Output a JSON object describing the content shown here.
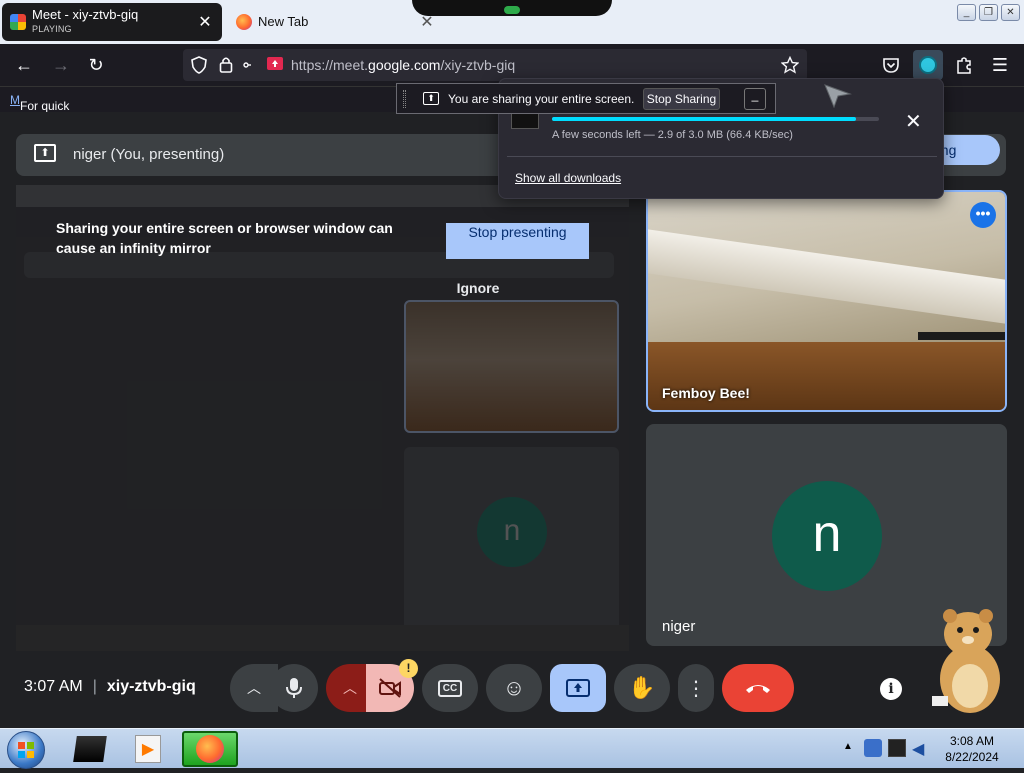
{
  "browser": {
    "tabs": [
      {
        "title": "Meet - xiy-ztvb-giq",
        "subtitle": "PLAYING",
        "active": true
      },
      {
        "title": "New Tab",
        "active": false
      }
    ],
    "url": {
      "prefix": "https://meet.",
      "domain": "google.com",
      "path": "/xiy-ztvb-giq"
    },
    "bookmarks_hint": "For quick access, place your bookmarks here on the bookmarks toolbar.",
    "bookmarks_link_glyph": "M"
  },
  "sharing_indicator": {
    "text": "You are sharing your entire screen.",
    "stop_label": "Stop Sharing",
    "minimize_label": "_"
  },
  "downloads": {
    "status": "A few seconds left — 2.9 of 3.0 MB (66.4 KB/sec)",
    "progress": 0.93,
    "show_all": "Show all downloads"
  },
  "meet": {
    "banner": {
      "label": "niger (You, presenting)",
      "stop_partial": "nting"
    },
    "mirror_warning": {
      "text": "Sharing your entire screen or browser window can cause an infinity mirror",
      "stop_label": "Stop presenting",
      "ignore_label": "Ignore"
    },
    "participants": [
      {
        "name": "Femboy Bee!",
        "more_icon": "more-horizontal-icon"
      },
      {
        "name": "niger",
        "initial": "n"
      }
    ],
    "controls": {
      "time": "3:07 AM",
      "separator": "|",
      "meeting_code": "xiy-ztvb-giq",
      "camera_warning_badge": "!",
      "info_glyph": "i"
    }
  },
  "taskbar": {
    "time": "3:08 AM",
    "date": "8/22/2024",
    "show_hidden_glyph": "▲"
  },
  "colors": {
    "meet_bg": "#202124",
    "accent_blue": "#a8c7fa",
    "end_call_red": "#ea4335",
    "avatar_green": "#0f5b4b",
    "download_progress": "#00ddff"
  }
}
